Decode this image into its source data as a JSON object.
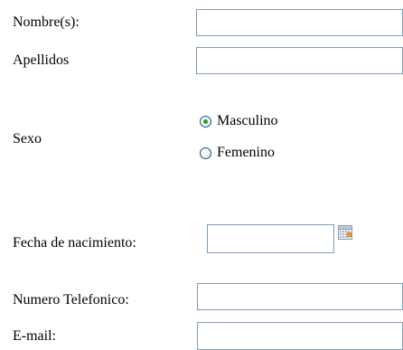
{
  "form": {
    "nombres": {
      "label": "Nombre(s):",
      "value": "",
      "placeholder": ""
    },
    "apellidos": {
      "label": "Apellidos",
      "value": "",
      "placeholder": ""
    },
    "sexo": {
      "label": "Sexo",
      "options": [
        {
          "label": "Masculino",
          "selected": true
        },
        {
          "label": "Femenino",
          "selected": false
        }
      ]
    },
    "fecha_nacimiento": {
      "label": "Fecha de nacimiento:",
      "value": "",
      "placeholder": "",
      "icon": "calendar-icon"
    },
    "telefono": {
      "label": "Numero Telefonico:",
      "value": "",
      "placeholder": ""
    },
    "email": {
      "label": "E-mail:",
      "value": "",
      "placeholder": ""
    }
  }
}
